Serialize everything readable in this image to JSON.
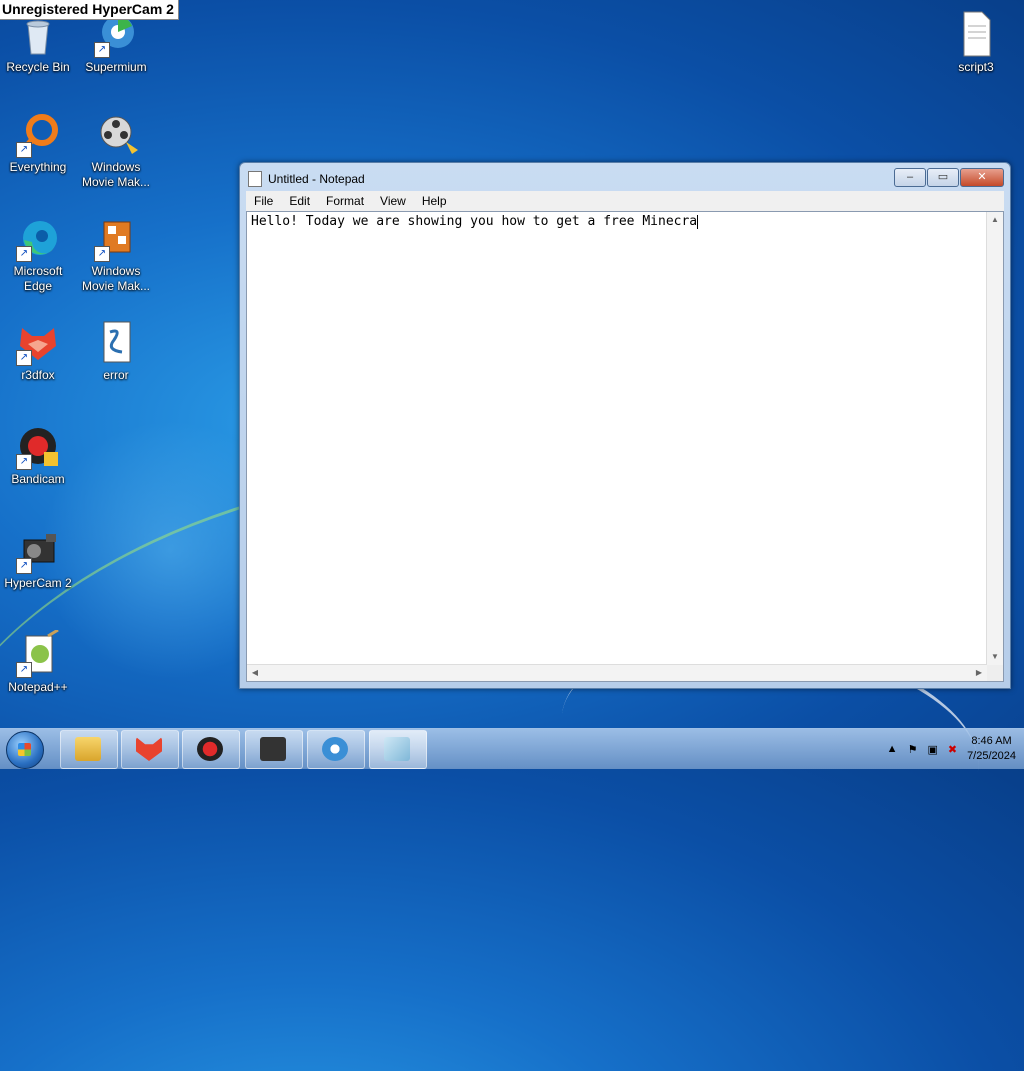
{
  "watermark": "Unregistered HyperCam 2",
  "desktop_icons": [
    {
      "label": "Recycle Bin",
      "icon": "recycle-bin-icon"
    },
    {
      "label": "Supermium",
      "icon": "supermium-icon"
    },
    {
      "label": "Everything",
      "icon": "everything-icon"
    },
    {
      "label": "Windows Movie Mak...",
      "icon": "movie-maker-icon"
    },
    {
      "label": "Microsoft Edge",
      "icon": "edge-icon"
    },
    {
      "label": "Windows Movie Mak...",
      "icon": "movie-maker-icon"
    },
    {
      "label": "r3dfox",
      "icon": "r3dfox-icon"
    },
    {
      "label": "error",
      "icon": "script-file-icon"
    },
    {
      "label": "Bandicam",
      "icon": "bandicam-icon"
    },
    {
      "label": "HyperCam 2",
      "icon": "hypercam-icon"
    },
    {
      "label": "Notepad++",
      "icon": "notepadpp-icon"
    },
    {
      "label": "script3",
      "icon": "text-file-icon"
    }
  ],
  "notepad": {
    "title": "Untitled - Notepad",
    "menu": [
      "File",
      "Edit",
      "Format",
      "View",
      "Help"
    ],
    "content": "Hello! Today we are showing you how to get a free Minecra",
    "controls": {
      "minimize": "–",
      "maximize": "▭",
      "close": "✕"
    }
  },
  "taskbar": {
    "pinned": [
      "explorer-icon",
      "r3dfox-icon",
      "bandicam-icon",
      "hypercam-icon",
      "supermium-icon",
      "notepad-icon"
    ],
    "clock_time": "8:46 AM",
    "clock_date": "7/25/2024",
    "tray_icons": [
      "show-hidden-icon",
      "flag-icon",
      "network-icon",
      "volume-muted-icon"
    ]
  },
  "colors": {
    "accent": "#1670c9",
    "close": "#c44a2a"
  }
}
